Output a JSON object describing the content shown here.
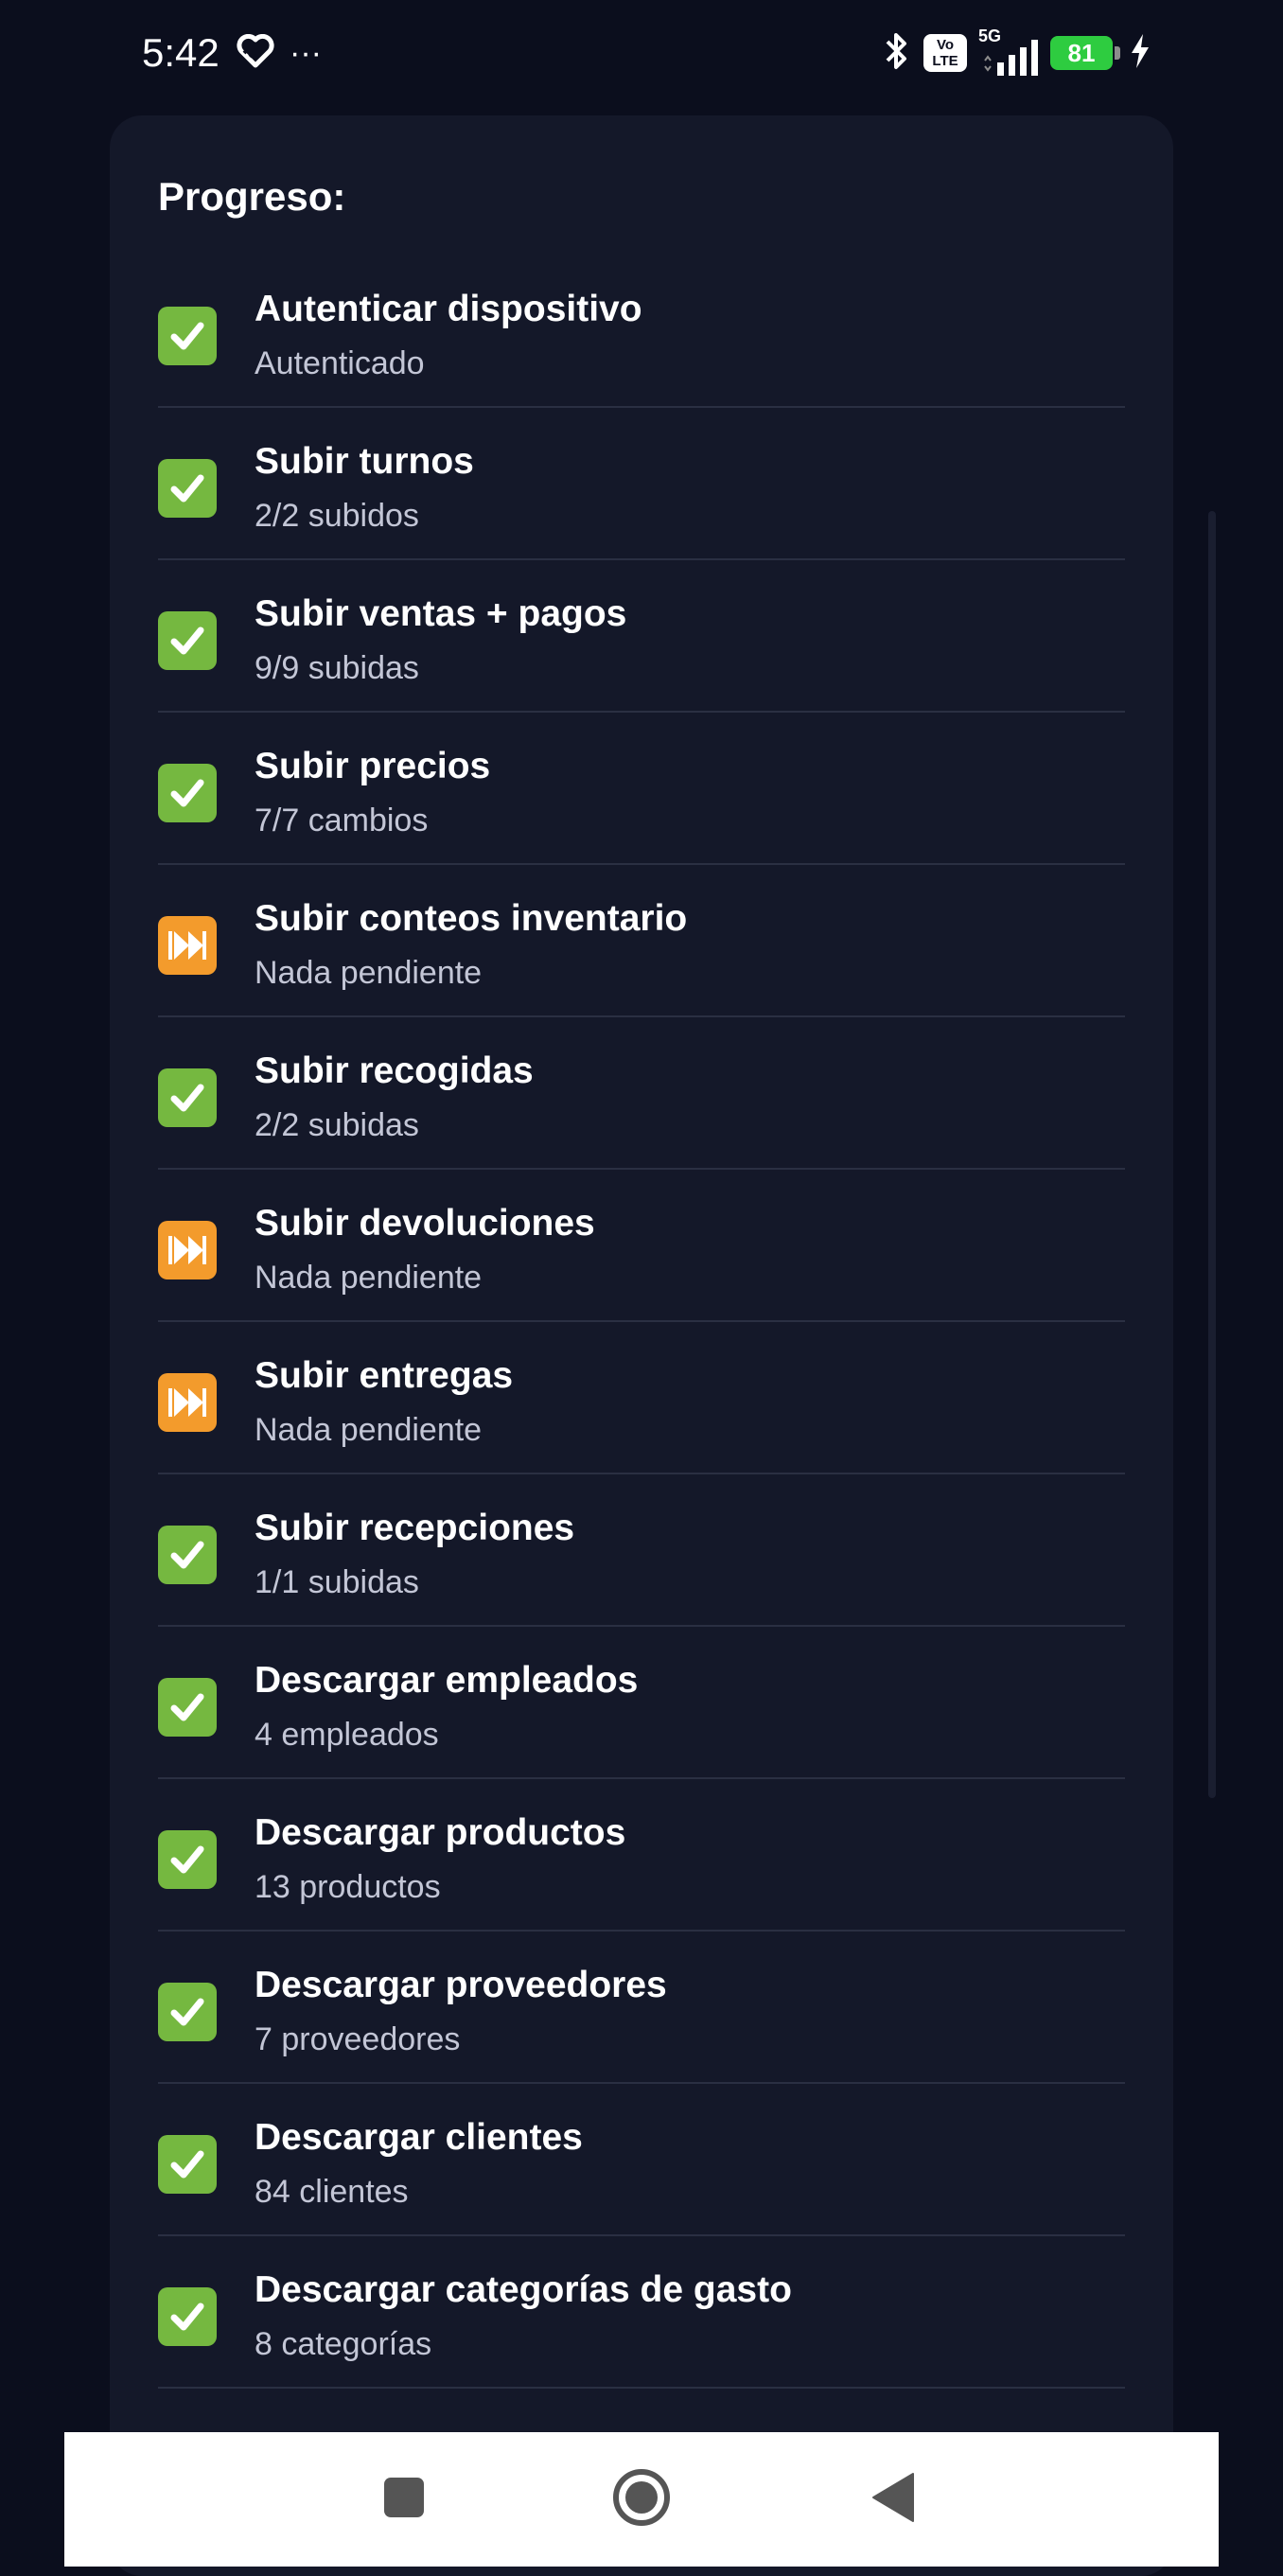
{
  "status_bar": {
    "time": "5:42",
    "more": "···",
    "network": "5G",
    "volte_top": "Vo",
    "volte_bottom": "LTE",
    "battery": "81",
    "icons": [
      "heart-pulse-icon",
      "bluetooth-icon",
      "signal-icon",
      "charging-icon"
    ]
  },
  "card": {
    "title": "Progreso:",
    "steps": [
      {
        "title": "Autenticar dispositivo",
        "subtitle": "Autenticado",
        "status": "done",
        "icon": "check-icon"
      },
      {
        "title": "Subir turnos",
        "subtitle": "2/2 subidos",
        "status": "done",
        "icon": "check-icon"
      },
      {
        "title": "Subir ventas + pagos",
        "subtitle": "9/9 subidas",
        "status": "done",
        "icon": "check-icon"
      },
      {
        "title": "Subir precios",
        "subtitle": "7/7 cambios",
        "status": "done",
        "icon": "check-icon"
      },
      {
        "title": "Subir conteos inventario",
        "subtitle": "Nada pendiente",
        "status": "skipped",
        "icon": "fast-forward-icon"
      },
      {
        "title": "Subir recogidas",
        "subtitle": "2/2 subidas",
        "status": "done",
        "icon": "check-icon"
      },
      {
        "title": "Subir devoluciones",
        "subtitle": "Nada pendiente",
        "status": "skipped",
        "icon": "fast-forward-icon"
      },
      {
        "title": "Subir entregas",
        "subtitle": "Nada pendiente",
        "status": "skipped",
        "icon": "fast-forward-icon"
      },
      {
        "title": "Subir recepciones",
        "subtitle": "1/1 subidas",
        "status": "done",
        "icon": "check-icon"
      },
      {
        "title": "Descargar empleados",
        "subtitle": "4 empleados",
        "status": "done",
        "icon": "check-icon"
      },
      {
        "title": "Descargar productos",
        "subtitle": "13 productos",
        "status": "done",
        "icon": "check-icon"
      },
      {
        "title": "Descargar proveedores",
        "subtitle": "7 proveedores",
        "status": "done",
        "icon": "check-icon"
      },
      {
        "title": "Descargar clientes",
        "subtitle": "84 clientes",
        "status": "done",
        "icon": "check-icon"
      },
      {
        "title": "Descargar categorías de gasto",
        "subtitle": "8 categorías",
        "status": "done",
        "icon": "check-icon"
      }
    ]
  },
  "nav_bar": {
    "icons": [
      "recent-apps-icon",
      "home-icon",
      "back-icon"
    ]
  },
  "colors": {
    "background": "#0b0e1d",
    "card": "#141829",
    "done": "#75b840",
    "skipped": "#f39b2c",
    "subtitle": "#c3c6d6",
    "divider": "#2a2f42"
  }
}
